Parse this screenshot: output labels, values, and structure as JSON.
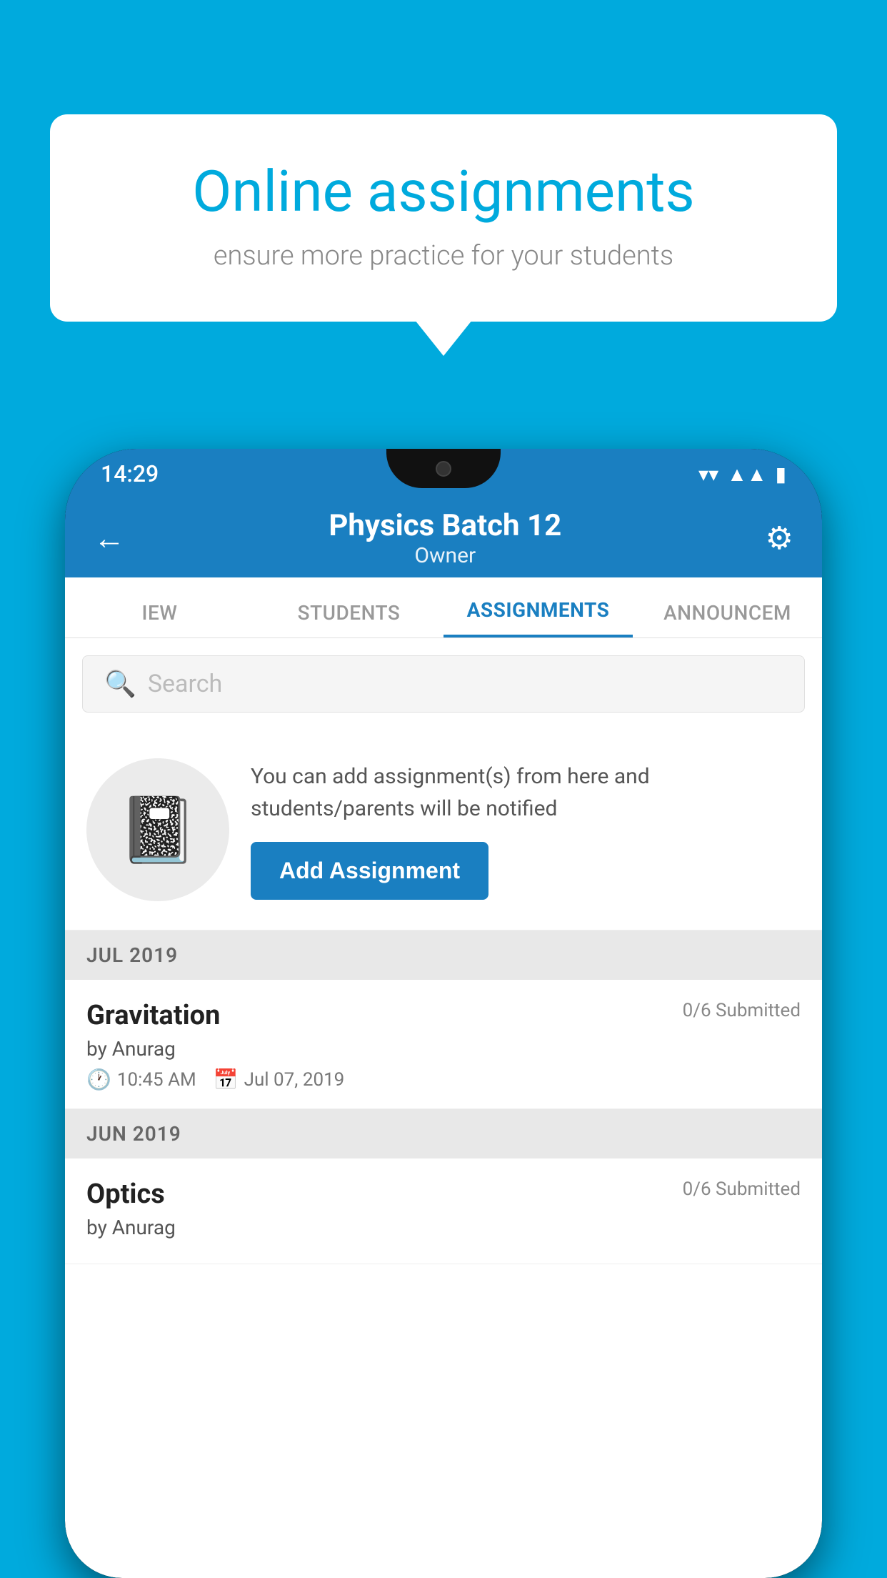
{
  "background_color": "#00AADD",
  "speech_bubble": {
    "title": "Online assignments",
    "subtitle": "ensure more practice for your students"
  },
  "status_bar": {
    "time": "14:29",
    "icons": [
      "wifi",
      "signal",
      "battery"
    ]
  },
  "header": {
    "title": "Physics Batch 12",
    "subtitle": "Owner",
    "back_label": "←",
    "settings_label": "⚙"
  },
  "tabs": [
    {
      "label": "IEW",
      "active": false
    },
    {
      "label": "STUDENTS",
      "active": false
    },
    {
      "label": "ASSIGNMENTS",
      "active": true
    },
    {
      "label": "ANNOUNCEM",
      "active": false
    }
  ],
  "search": {
    "placeholder": "Search"
  },
  "add_assignment_section": {
    "description": "You can add assignment(s) from here and students/parents will be notified",
    "button_label": "Add Assignment"
  },
  "sections": [
    {
      "month": "JUL 2019",
      "assignments": [
        {
          "name": "Gravitation",
          "submitted": "0/6 Submitted",
          "by": "by Anurag",
          "time": "10:45 AM",
          "date": "Jul 07, 2019"
        }
      ]
    },
    {
      "month": "JUN 2019",
      "assignments": [
        {
          "name": "Optics",
          "submitted": "0/6 Submitted",
          "by": "by Anurag",
          "time": "",
          "date": ""
        }
      ]
    }
  ]
}
